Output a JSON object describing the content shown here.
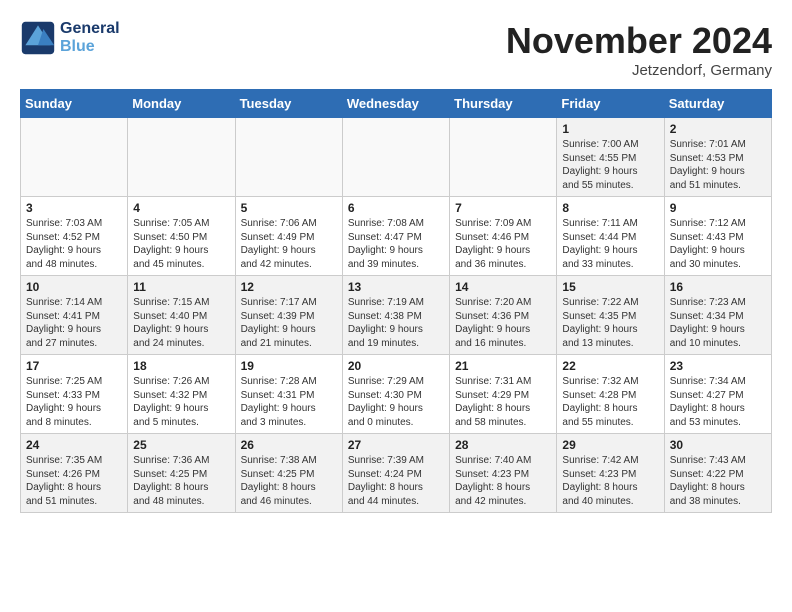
{
  "header": {
    "logo_line1": "General",
    "logo_line2": "Blue",
    "month": "November 2024",
    "location": "Jetzendorf, Germany"
  },
  "days_of_week": [
    "Sunday",
    "Monday",
    "Tuesday",
    "Wednesday",
    "Thursday",
    "Friday",
    "Saturday"
  ],
  "weeks": [
    [
      {
        "day": "",
        "info": ""
      },
      {
        "day": "",
        "info": ""
      },
      {
        "day": "",
        "info": ""
      },
      {
        "day": "",
        "info": ""
      },
      {
        "day": "",
        "info": ""
      },
      {
        "day": "1",
        "info": "Sunrise: 7:00 AM\nSunset: 4:55 PM\nDaylight: 9 hours\nand 55 minutes."
      },
      {
        "day": "2",
        "info": "Sunrise: 7:01 AM\nSunset: 4:53 PM\nDaylight: 9 hours\nand 51 minutes."
      }
    ],
    [
      {
        "day": "3",
        "info": "Sunrise: 7:03 AM\nSunset: 4:52 PM\nDaylight: 9 hours\nand 48 minutes."
      },
      {
        "day": "4",
        "info": "Sunrise: 7:05 AM\nSunset: 4:50 PM\nDaylight: 9 hours\nand 45 minutes."
      },
      {
        "day": "5",
        "info": "Sunrise: 7:06 AM\nSunset: 4:49 PM\nDaylight: 9 hours\nand 42 minutes."
      },
      {
        "day": "6",
        "info": "Sunrise: 7:08 AM\nSunset: 4:47 PM\nDaylight: 9 hours\nand 39 minutes."
      },
      {
        "day": "7",
        "info": "Sunrise: 7:09 AM\nSunset: 4:46 PM\nDaylight: 9 hours\nand 36 minutes."
      },
      {
        "day": "8",
        "info": "Sunrise: 7:11 AM\nSunset: 4:44 PM\nDaylight: 9 hours\nand 33 minutes."
      },
      {
        "day": "9",
        "info": "Sunrise: 7:12 AM\nSunset: 4:43 PM\nDaylight: 9 hours\nand 30 minutes."
      }
    ],
    [
      {
        "day": "10",
        "info": "Sunrise: 7:14 AM\nSunset: 4:41 PM\nDaylight: 9 hours\nand 27 minutes."
      },
      {
        "day": "11",
        "info": "Sunrise: 7:15 AM\nSunset: 4:40 PM\nDaylight: 9 hours\nand 24 minutes."
      },
      {
        "day": "12",
        "info": "Sunrise: 7:17 AM\nSunset: 4:39 PM\nDaylight: 9 hours\nand 21 minutes."
      },
      {
        "day": "13",
        "info": "Sunrise: 7:19 AM\nSunset: 4:38 PM\nDaylight: 9 hours\nand 19 minutes."
      },
      {
        "day": "14",
        "info": "Sunrise: 7:20 AM\nSunset: 4:36 PM\nDaylight: 9 hours\nand 16 minutes."
      },
      {
        "day": "15",
        "info": "Sunrise: 7:22 AM\nSunset: 4:35 PM\nDaylight: 9 hours\nand 13 minutes."
      },
      {
        "day": "16",
        "info": "Sunrise: 7:23 AM\nSunset: 4:34 PM\nDaylight: 9 hours\nand 10 minutes."
      }
    ],
    [
      {
        "day": "17",
        "info": "Sunrise: 7:25 AM\nSunset: 4:33 PM\nDaylight: 9 hours\nand 8 minutes."
      },
      {
        "day": "18",
        "info": "Sunrise: 7:26 AM\nSunset: 4:32 PM\nDaylight: 9 hours\nand 5 minutes."
      },
      {
        "day": "19",
        "info": "Sunrise: 7:28 AM\nSunset: 4:31 PM\nDaylight: 9 hours\nand 3 minutes."
      },
      {
        "day": "20",
        "info": "Sunrise: 7:29 AM\nSunset: 4:30 PM\nDaylight: 9 hours\nand 0 minutes."
      },
      {
        "day": "21",
        "info": "Sunrise: 7:31 AM\nSunset: 4:29 PM\nDaylight: 8 hours\nand 58 minutes."
      },
      {
        "day": "22",
        "info": "Sunrise: 7:32 AM\nSunset: 4:28 PM\nDaylight: 8 hours\nand 55 minutes."
      },
      {
        "day": "23",
        "info": "Sunrise: 7:34 AM\nSunset: 4:27 PM\nDaylight: 8 hours\nand 53 minutes."
      }
    ],
    [
      {
        "day": "24",
        "info": "Sunrise: 7:35 AM\nSunset: 4:26 PM\nDaylight: 8 hours\nand 51 minutes."
      },
      {
        "day": "25",
        "info": "Sunrise: 7:36 AM\nSunset: 4:25 PM\nDaylight: 8 hours\nand 48 minutes."
      },
      {
        "day": "26",
        "info": "Sunrise: 7:38 AM\nSunset: 4:25 PM\nDaylight: 8 hours\nand 46 minutes."
      },
      {
        "day": "27",
        "info": "Sunrise: 7:39 AM\nSunset: 4:24 PM\nDaylight: 8 hours\nand 44 minutes."
      },
      {
        "day": "28",
        "info": "Sunrise: 7:40 AM\nSunset: 4:23 PM\nDaylight: 8 hours\nand 42 minutes."
      },
      {
        "day": "29",
        "info": "Sunrise: 7:42 AM\nSunset: 4:23 PM\nDaylight: 8 hours\nand 40 minutes."
      },
      {
        "day": "30",
        "info": "Sunrise: 7:43 AM\nSunset: 4:22 PM\nDaylight: 8 hours\nand 38 minutes."
      }
    ]
  ]
}
